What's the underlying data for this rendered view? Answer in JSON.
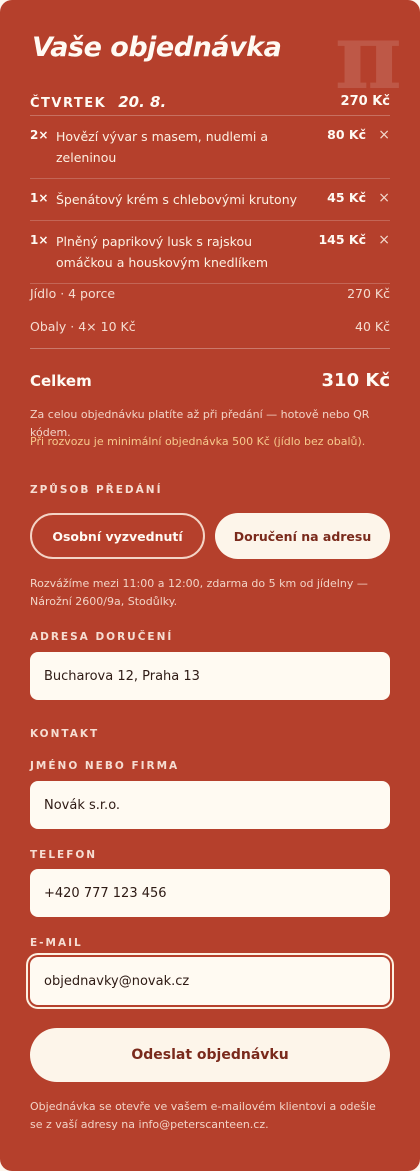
{
  "header": {
    "title": "Vaše objednávka",
    "logo_glyph": "π"
  },
  "day": {
    "name": "ČTVRTEK",
    "date": "20. 8.",
    "total": "270 Kč"
  },
  "items": [
    {
      "qty": "2×",
      "name": "Hovězí vývar s masem, nudlemi a zeleninou",
      "price": "80 Kč",
      "remove_icon": "×"
    },
    {
      "qty": "1×",
      "name": "Špenátový krém s chlebovými krutony",
      "price": "45 Kč",
      "remove_icon": "×"
    },
    {
      "qty": "1×",
      "name": "Plněný paprikový lusk s rajskou omáčkou a houskovým knedlíkem",
      "price": "145 Kč",
      "remove_icon": "×"
    }
  ],
  "summary": {
    "food_label": "Jídlo · 4 porce",
    "food_value": "270 Kč",
    "packaging_label": "Obaly · 4× 10 Kč",
    "packaging_value": "40 Kč",
    "total_label": "Celkem",
    "total_value": "310 Kč"
  },
  "notes": {
    "payment": "Za celou objednávku platíte až při předání — hotově nebo QR kódem.",
    "minimum": "Při rozvozu je minimální objednávka 500 Kč (jídlo bez obalů)."
  },
  "delivery": {
    "section_label": "ZPŮSOB PŘEDÁNÍ",
    "option_pickup": "Osobní vyzvednutí",
    "option_delivery": "Doručení na adresu",
    "info": "Rozvážíme mezi 11:00 a 12:00, zdarma do 5 km od jídelny — Nárožní 2600/9a, Stodůlky.",
    "address_label": "ADRESA DORUČENÍ",
    "address_value": "Bucharova 12, Praha 13"
  },
  "contact": {
    "section_label": "KONTAKT",
    "name_label": "JMÉNO NEBO FIRMA",
    "name_value": "Novák s.r.o.",
    "phone_label": "TELEFON",
    "phone_value": "+420 777 123 456",
    "email_label": "E-MAIL",
    "email_value": "objednavky@novak.cz"
  },
  "submit": {
    "label": "Odeslat objednávku",
    "footnote": "Objednávka se otevře ve vašem e-mailovém klientovi a odešle se z vaší adresy na info@peterscanteen.cz."
  },
  "colors": {
    "panel": "#b5402c",
    "cream": "#fdf5ea",
    "accent_text": "#7a2a1c",
    "warning": "#f7c98c"
  }
}
